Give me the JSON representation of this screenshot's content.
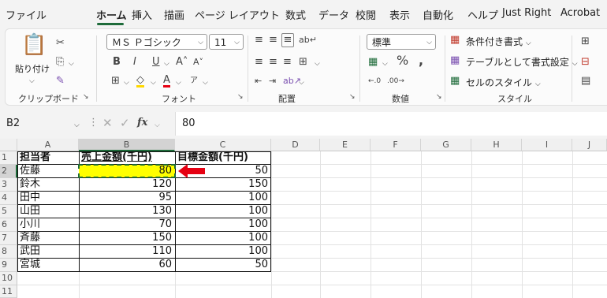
{
  "menu": [
    "ファイル",
    "ホーム",
    "挿入",
    "描画",
    "ページ レイアウト",
    "数式",
    "データ",
    "校閲",
    "表示",
    "自動化",
    "ヘルプ",
    "Just Right",
    "Acrobat"
  ],
  "ribbon": {
    "clipboard": {
      "paste_label": "貼り付け",
      "group_label": "クリップボード"
    },
    "font": {
      "font_name": "ＭＳ Ｐゴシック",
      "font_size": "11",
      "group_label": "フォント"
    },
    "align": {
      "group_label": "配置"
    },
    "number": {
      "format": "標準",
      "group_label": "数値"
    },
    "style": {
      "conditional": "条件付き書式",
      "table": "テーブルとして書式設定",
      "cell_style": "セルのスタイル",
      "group_label": "スタイル"
    }
  },
  "formula": {
    "namebox": "B2",
    "fx": "fx",
    "value": "80"
  },
  "columns": [
    "A",
    "B",
    "C",
    "D",
    "E",
    "F",
    "G",
    "H",
    "I",
    "J"
  ],
  "rows": [
    "1",
    "2",
    "3",
    "4",
    "5",
    "6",
    "7",
    "8",
    "9",
    "10",
    "11"
  ],
  "table": {
    "headers": [
      "担当者",
      "売上金額(千円)",
      "目標金額(千円)"
    ],
    "data": [
      [
        "佐藤",
        "80",
        "50"
      ],
      [
        "鈴木",
        "120",
        "150"
      ],
      [
        "田中",
        "95",
        "100"
      ],
      [
        "山田",
        "130",
        "100"
      ],
      [
        "小川",
        "70",
        "100"
      ],
      [
        "斉藤",
        "150",
        "100"
      ],
      [
        "武田",
        "110",
        "100"
      ],
      [
        "宮城",
        "60",
        "50"
      ]
    ]
  },
  "colors": {
    "highlight": "#ffff00",
    "arrow": "#e60012",
    "accent": "#1e6b3a"
  }
}
